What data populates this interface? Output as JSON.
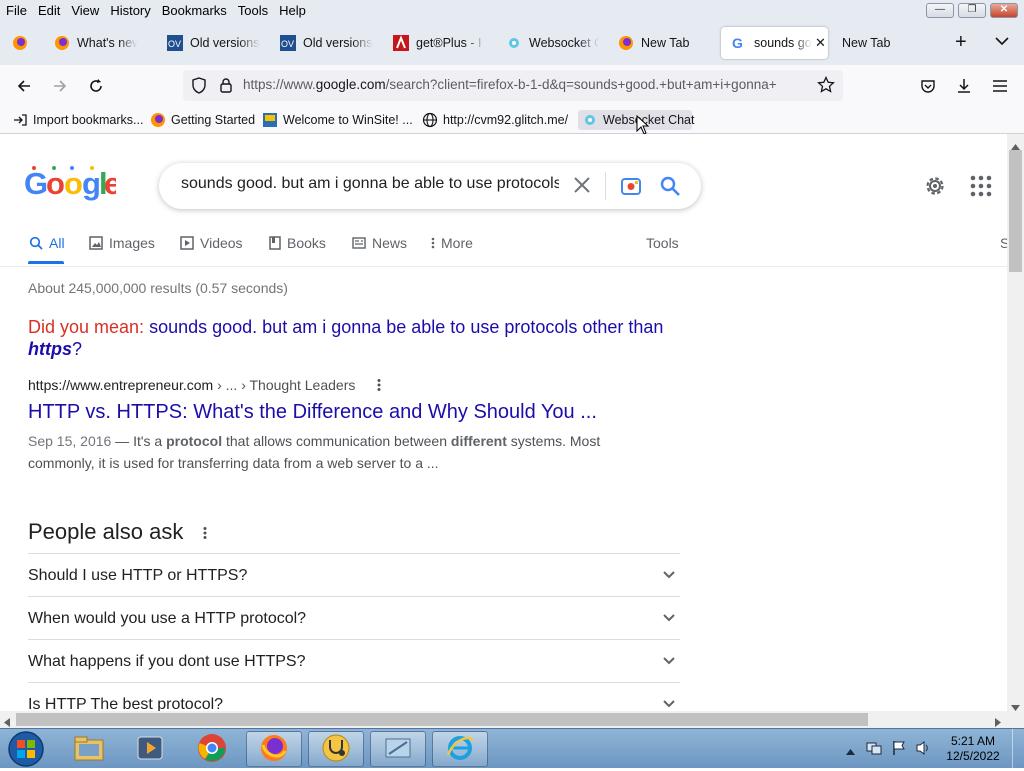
{
  "menubar": {
    "items": [
      "File",
      "Edit",
      "View",
      "History",
      "Bookmarks",
      "Tools",
      "Help"
    ]
  },
  "tabs": [
    {
      "title": "",
      "icon": "firefox-icon"
    },
    {
      "title": "What's new",
      "icon": "firefox-icon"
    },
    {
      "title": "Old versions",
      "icon": "oldversion-icon"
    },
    {
      "title": "Old versions",
      "icon": "oldversion-icon"
    },
    {
      "title": "get®Plus - I",
      "icon": "adobe-icon"
    },
    {
      "title": "Websocket C",
      "icon": "websocket-icon"
    },
    {
      "title": "New Tab",
      "icon": "firefox-icon"
    },
    {
      "title": "sounds go",
      "icon": "google-icon",
      "active": true
    },
    {
      "title": "New Tab",
      "icon": ""
    }
  ],
  "url": {
    "prefix": "https://www.",
    "domain": "google.com",
    "rest": "/search?client=firefox-b-1-d&q=sounds+good.+but+am+i+gonna+"
  },
  "bookmarks": [
    {
      "label": "Import bookmarks...",
      "icon": "import-icon"
    },
    {
      "label": "Getting Started",
      "icon": "firefox-icon"
    },
    {
      "label": "Welcome to WinSite! ...",
      "icon": "winsite-icon"
    },
    {
      "label": "http://cvm92.glitch.me/",
      "icon": "globe-icon"
    },
    {
      "label": "Websocket Chat",
      "icon": "websocket-icon"
    }
  ],
  "search": {
    "query": "sounds good. but am i gonna be able to use protocols other than https",
    "tabs": [
      "All",
      "Images",
      "Videos",
      "Books",
      "News",
      "More"
    ],
    "tools_label": "Tools",
    "cut_label": "S",
    "stats": "About 245,000,000 results (0.57 seconds)",
    "did_you_mean_label": "Did you mean:",
    "did_you_mean_text": "sounds good. but am i gonna be able to use protocols other than",
    "did_you_mean_bold": "https",
    "did_you_mean_end": "?"
  },
  "result": {
    "site": "https://www.entrepreneur.com",
    "breadcrumb": " › ... › Thought Leaders",
    "title": "HTTP vs. HTTPS: What's the Difference and Why Should You ...",
    "date": "Sep 15, 2016",
    "snippet_1": " — It's a ",
    "snippet_bold_1": "protocol",
    "snippet_2": " that allows communication between ",
    "snippet_bold_2": "different",
    "snippet_3": " systems. Most commonly, it is used for transferring data from a web server to a ..."
  },
  "people_also_ask": {
    "heading": "People also ask",
    "questions": [
      "Should I use HTTP or HTTPS?",
      "When would you use a HTTP protocol?",
      "What happens if you dont use HTTPS?",
      "Is HTTP The best protocol?"
    ]
  },
  "clock": {
    "time": "5:21 AM",
    "date": "12/5/2022"
  },
  "colors": {
    "link": "#1a0dab",
    "did_you_mean": "#d93025",
    "google_blue": "#1a73e8"
  }
}
